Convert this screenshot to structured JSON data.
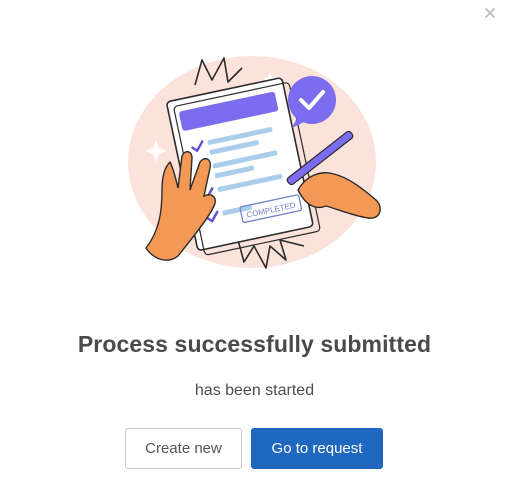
{
  "dialog": {
    "title": "Process successfully submitted",
    "subtitle": "has been started",
    "close_icon": "close-icon",
    "illustration": {
      "stamp_text": "COMPLETED",
      "icon": "checklist-illustration"
    },
    "actions": {
      "create_new_label": "Create new",
      "go_to_request_label": "Go to request"
    }
  },
  "colors": {
    "primary": "#1f67bf",
    "title": "#4a4a4a",
    "blob": "#fbe3dc",
    "accent_purple": "#7b6cf0"
  }
}
